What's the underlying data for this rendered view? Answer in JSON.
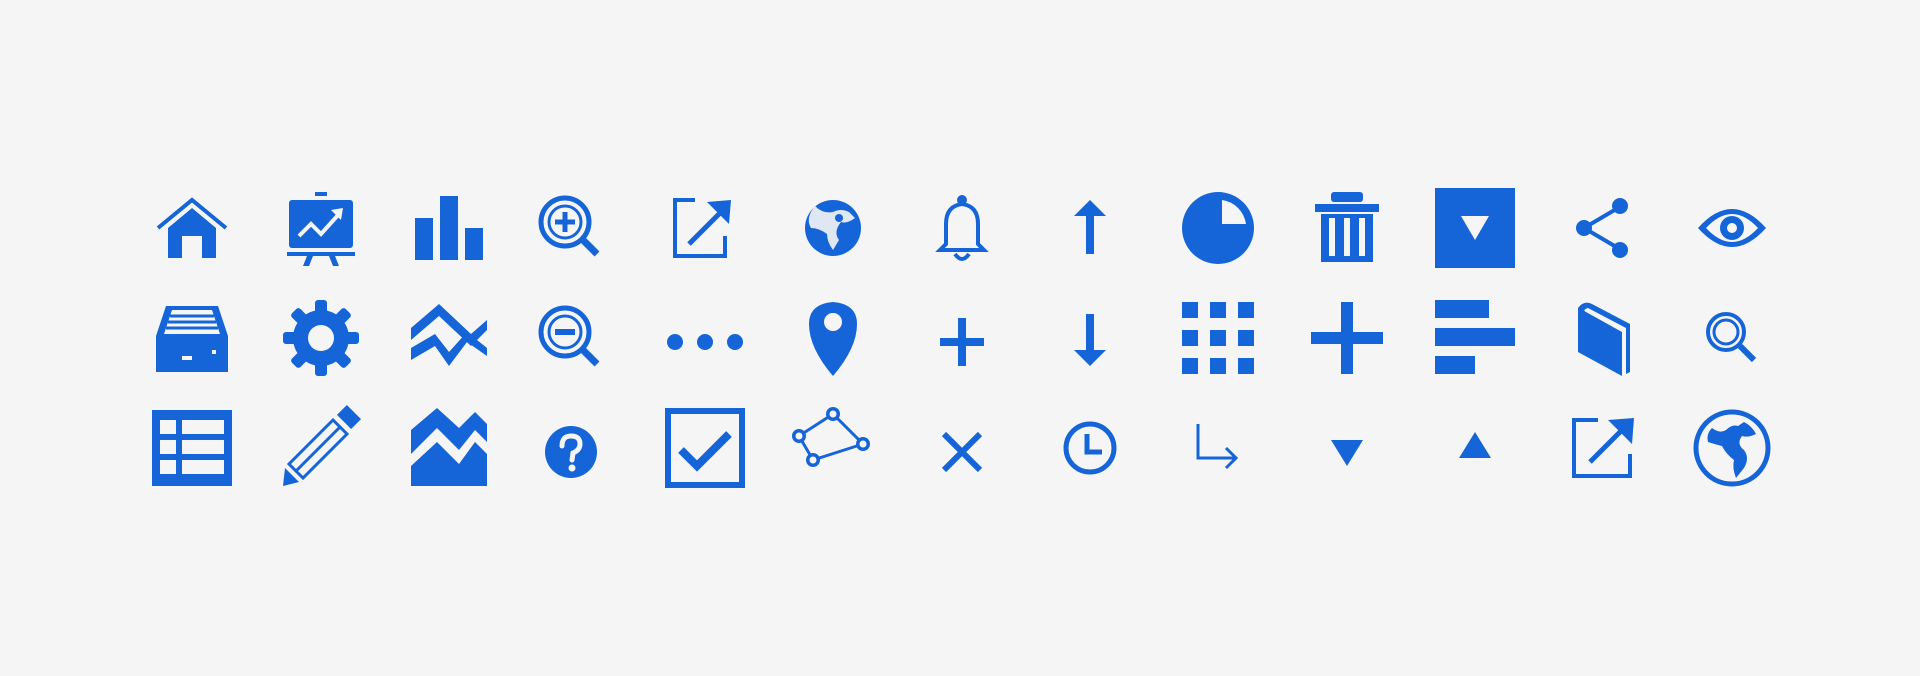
{
  "colors": {
    "icon": "#1565d8",
    "background": "#f5f5f5"
  },
  "icon_grid": {
    "rows": [
      [
        "home-icon",
        "presentation-chart-icon",
        "bar-chart-icon",
        "zoom-in-icon",
        "external-link-icon",
        "globe-icon",
        "bell-icon",
        "arrow-up-icon",
        "pie-chart-icon",
        "trash-icon",
        "dropdown-box-icon",
        "share-icon",
        "eye-icon"
      ],
      [
        "inbox-tray-icon",
        "gear-icon",
        "area-chart-icon",
        "zoom-out-icon",
        "more-horizontal-icon",
        "map-pin-icon",
        "plus-small-icon",
        "arrow-down-icon",
        "grid-view-icon",
        "plus-large-icon",
        "align-left-icon",
        "book-icon",
        "search-icon"
      ],
      [
        "table-icon",
        "pencil-icon",
        "stacked-area-chart-icon",
        "help-circle-icon",
        "checkbox-checked-icon",
        "polygon-tool-icon",
        "close-icon",
        "clock-icon",
        "arrow-turn-down-right-icon",
        "triangle-down-icon",
        "triangle-up-icon",
        "external-link-icon",
        "globe-outline-icon"
      ]
    ]
  }
}
